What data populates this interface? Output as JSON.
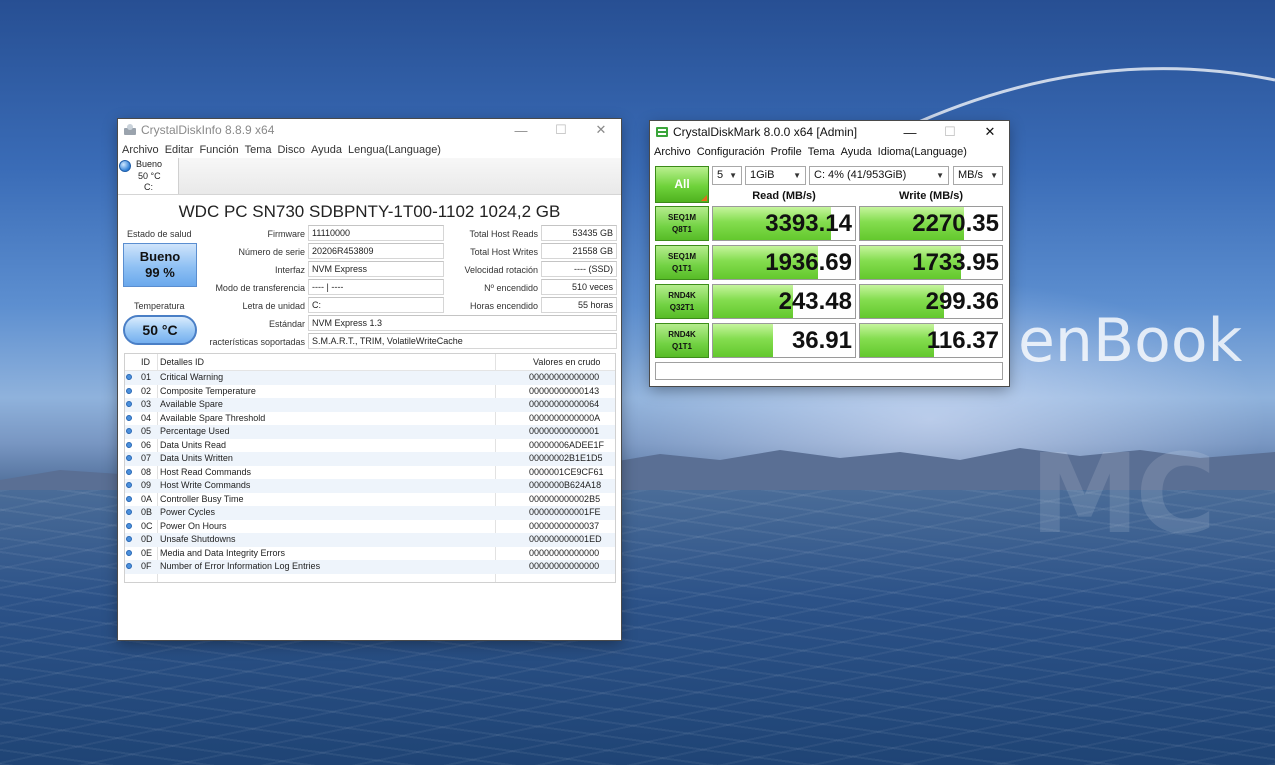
{
  "wallpaper": {
    "brand_text": "enBook",
    "corner_mark": "MC"
  },
  "diskinfo": {
    "title": "CrystalDiskInfo 8.8.9 x64",
    "menu": [
      "Archivo",
      "Editar",
      "Función",
      "Tema",
      "Disco",
      "Ayuda",
      "Lengua(Language)"
    ],
    "disk_tab": {
      "status": "Bueno",
      "temp": "50 °C",
      "letter": "C:"
    },
    "disk_title": "WDC PC SN730 SDBPNTY-1T00-1102 1024,2 GB",
    "health_label": "Estado de salud",
    "health_status": "Bueno",
    "health_percent": "99 %",
    "temp_label": "Temperatura",
    "temp_value": "50 °C",
    "fields": {
      "firmware_label": "Firmware",
      "firmware": "11110000",
      "serial_label": "Número de serie",
      "serial": "20206R453809",
      "interface_label": "Interfaz",
      "interface": "NVM Express",
      "transfer_label": "Modo de transferencia",
      "transfer": "---- | ----",
      "drive_letter_label": "Letra de unidad",
      "drive_letter": "C:",
      "standard_label": "Estándar",
      "standard": "NVM Express 1.3",
      "features_label": "racterísticas soportadas",
      "features": "S.M.A.R.T., TRIM, VolatileWriteCache",
      "host_reads_label": "Total Host Reads",
      "host_reads": "53435 GB",
      "host_writes_label": "Total Host Writes",
      "host_writes": "21558 GB",
      "rotation_label": "Velocidad rotación",
      "rotation": "---- (SSD)",
      "power_count_label": "Nº encendido",
      "power_count": "510 veces",
      "power_hours_label": "Horas encendido",
      "power_hours": "55 horas"
    },
    "smart_headers": {
      "id": "ID",
      "detail": "Detalles ID",
      "raw": "Valores en crudo"
    },
    "smart_rows": [
      {
        "id": "01",
        "name": "Critical Warning",
        "raw": "00000000000000"
      },
      {
        "id": "02",
        "name": "Composite Temperature",
        "raw": "00000000000143"
      },
      {
        "id": "03",
        "name": "Available Spare",
        "raw": "00000000000064"
      },
      {
        "id": "04",
        "name": "Available Spare Threshold",
        "raw": "0000000000000A"
      },
      {
        "id": "05",
        "name": "Percentage Used",
        "raw": "00000000000001"
      },
      {
        "id": "06",
        "name": "Data Units Read",
        "raw": "00000006ADEE1F"
      },
      {
        "id": "07",
        "name": "Data Units Written",
        "raw": "00000002B1E1D5"
      },
      {
        "id": "08",
        "name": "Host Read Commands",
        "raw": "0000001CE9CF61"
      },
      {
        "id": "09",
        "name": "Host Write Commands",
        "raw": "0000000B624A18"
      },
      {
        "id": "0A",
        "name": "Controller Busy Time",
        "raw": "000000000002B5"
      },
      {
        "id": "0B",
        "name": "Power Cycles",
        "raw": "000000000001FE"
      },
      {
        "id": "0C",
        "name": "Power On Hours",
        "raw": "00000000000037"
      },
      {
        "id": "0D",
        "name": "Unsafe Shutdowns",
        "raw": "000000000001ED"
      },
      {
        "id": "0E",
        "name": "Media and Data Integrity Errors",
        "raw": "00000000000000"
      },
      {
        "id": "0F",
        "name": "Number of Error Information Log Entries",
        "raw": "00000000000000"
      }
    ]
  },
  "diskmark": {
    "title": "CrystalDiskMark 8.0.0 x64 [Admin]",
    "menu": [
      "Archivo",
      "Configuración",
      "Profile",
      "Tema",
      "Ayuda",
      "Idioma(Language)"
    ],
    "all_label": "All",
    "count": "5",
    "size": "1GiB",
    "drive": "C: 4% (41/953GiB)",
    "unit": "MB/s",
    "read_header": "Read (MB/s)",
    "write_header": "Write (MB/s)",
    "rows": [
      {
        "line1": "SEQ1M",
        "line2": "Q8T1",
        "read": "3393.14",
        "write": "2270.35",
        "read_fill": 0.83,
        "write_fill": 0.73
      },
      {
        "line1": "SEQ1M",
        "line2": "Q1T1",
        "read": "1936.69",
        "write": "1733.95",
        "read_fill": 0.74,
        "write_fill": 0.71
      },
      {
        "line1": "RND4K",
        "line2": "Q32T1",
        "read": "243.48",
        "write": "299.36",
        "read_fill": 0.56,
        "write_fill": 0.59
      },
      {
        "line1": "RND4K",
        "line2": "Q1T1",
        "read": "36.91",
        "write": "116.37",
        "read_fill": 0.42,
        "write_fill": 0.52
      }
    ],
    "comment": ""
  }
}
